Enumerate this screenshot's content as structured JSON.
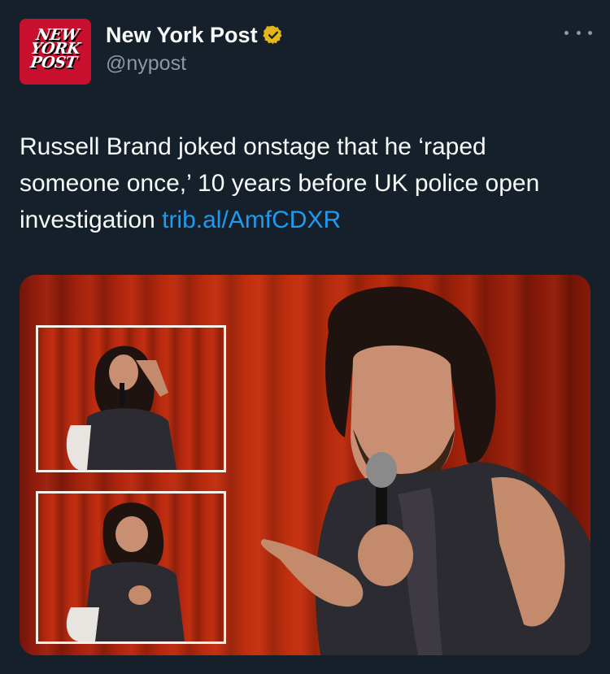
{
  "account": {
    "logo_alt_name": "NEW YORK POST",
    "display_name": "New York Post",
    "handle": "@nypost",
    "verified": true,
    "verified_color": "#e2b719"
  },
  "tweet": {
    "text": "Russell Brand joked onstage that he ‘raped someone once,’ 10 years before UK police open investigation",
    "link_text": "trib.al/AmfCDXR",
    "link_color": "#1d9bf0"
  },
  "media": {
    "description_icon": "photo-collage",
    "insets": 2
  },
  "theme": {
    "background": "#15202b",
    "brand": "#c8102e"
  }
}
